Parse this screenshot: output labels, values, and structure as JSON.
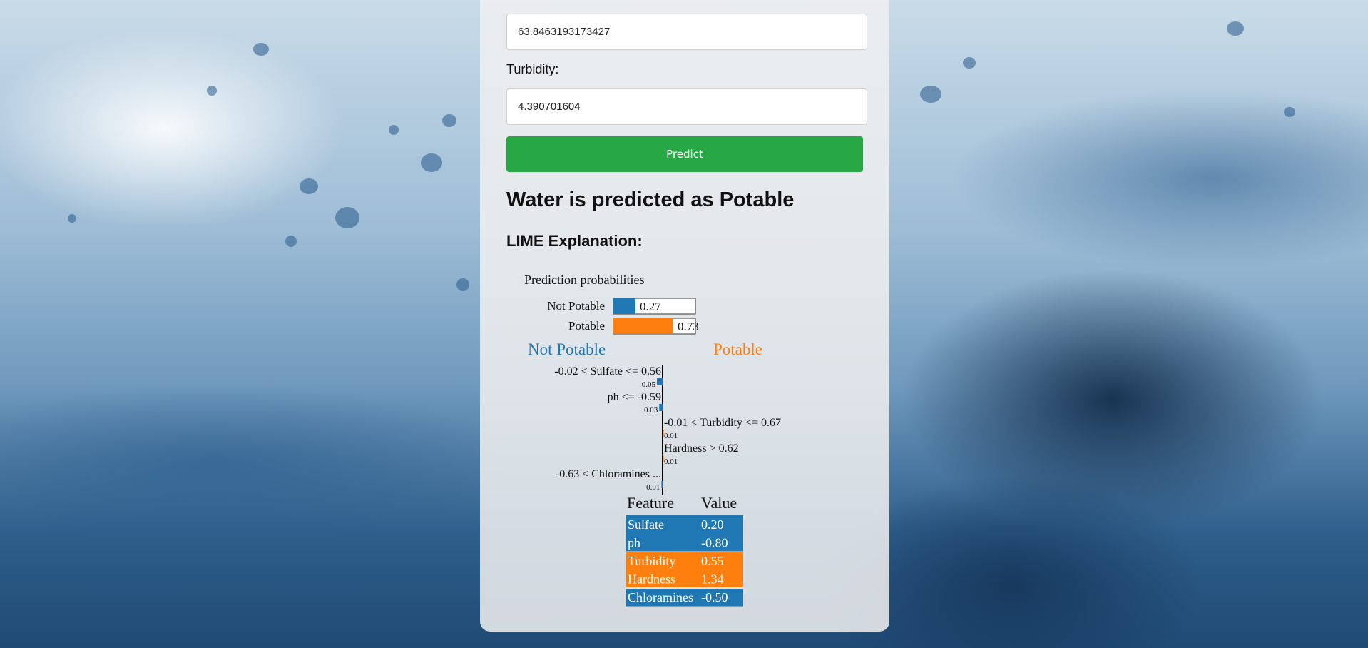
{
  "form": {
    "prev_field_value": "63.8463193173427",
    "turbidity_label": "Turbidity:",
    "turbidity_value": "4.390701604",
    "predict_label": "Predict"
  },
  "result": {
    "text": "Water is predicted as Potable"
  },
  "lime": {
    "heading": "LIME Explanation:",
    "probabilities_title": "Prediction probabilities",
    "class_labels": [
      "Not Potable",
      "Potable"
    ],
    "colors": {
      "not_potable": "#1f77b4",
      "potable": "#ff7f0e"
    },
    "chart_data": [
      {
        "type": "bar",
        "orientation": "horizontal",
        "title": "Prediction probabilities",
        "categories": [
          "Not Potable",
          "Potable"
        ],
        "values": [
          0.27,
          0.73
        ],
        "value_labels": [
          "0.27",
          "0.73"
        ],
        "xlim": [
          0,
          1
        ]
      },
      {
        "type": "bar",
        "orientation": "horizontal",
        "left_label": "Not Potable",
        "right_label": "Potable",
        "categories": [
          "-0.02 < Sulfate <= 0.56",
          "ph <= -0.59",
          "-0.01 < Turbidity <= 0.67",
          "Hardness > 0.62",
          "-0.63 < Chloramines ..."
        ],
        "values": [
          -0.05,
          -0.03,
          0.01,
          0.01,
          -0.01
        ],
        "value_labels": [
          "0.05",
          "0.03",
          "0.01",
          "0.01",
          "0.01"
        ]
      },
      {
        "type": "table",
        "columns": [
          "Feature",
          "Value"
        ],
        "rows": [
          {
            "feature": "Sulfate",
            "value": "0.20",
            "class": "not_potable"
          },
          {
            "feature": "ph",
            "value": "-0.80",
            "class": "not_potable"
          },
          {
            "feature": "Turbidity",
            "value": "0.55",
            "class": "potable"
          },
          {
            "feature": "Hardness",
            "value": "1.34",
            "class": "potable"
          },
          {
            "feature": "Chloramines",
            "value": "-0.50",
            "class": "not_potable"
          }
        ]
      }
    ]
  }
}
